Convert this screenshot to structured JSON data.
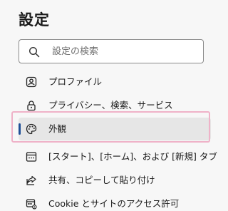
{
  "page": {
    "title": "設定"
  },
  "search": {
    "placeholder": "設定の検索",
    "value": ""
  },
  "nav": {
    "items": [
      {
        "label": "プロファイル",
        "icon": "profile-icon"
      },
      {
        "label": "プライバシー、検索、サービス",
        "icon": "lock-icon"
      },
      {
        "label": "外観",
        "icon": "palette-icon",
        "selected": true
      },
      {
        "label": "[スタート]、[ホーム]、および [新規] タブ",
        "icon": "start-home-icon"
      },
      {
        "label": "共有、コピーして貼り付け",
        "icon": "share-icon"
      },
      {
        "label": "Cookie とサイトのアクセス許可",
        "icon": "site-permissions-icon"
      }
    ]
  },
  "colors": {
    "background": "#f7f7f7",
    "selected_background": "#e6e6e6",
    "accent": "#1f4f96",
    "highlight_frame": "#efb2c8"
  }
}
